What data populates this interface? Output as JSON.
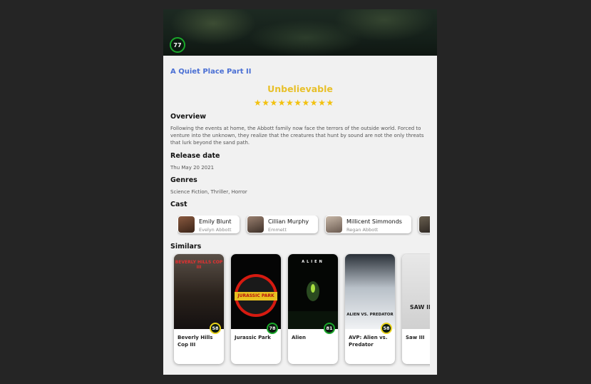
{
  "movie": {
    "score": "77",
    "title": "A Quiet Place Part II",
    "tagline": "Unbelievable",
    "stars": "★★★★★★★★★★",
    "colors": {
      "title": "#4a6fd4",
      "tagline": "#e8c02a",
      "star": "#f2c10f",
      "score_ring": "#1aa82a"
    }
  },
  "sections": {
    "overview_label": "Overview",
    "overview": "Following the events at home, the Abbott family now face the terrors of the outside world. Forced to venture into the unknown, they realize that the creatures that hunt by sound are not the only threats that lurk beyond the sand path.",
    "release_label": "Release date",
    "release": "Thu May 20 2021",
    "genres_label": "Genres",
    "genres": "Science Fiction, Thriller, Horror",
    "cast_label": "Cast",
    "similars_label": "Similars"
  },
  "cast": [
    {
      "name": "Emily Blunt",
      "role": "Evelyn Abbott"
    },
    {
      "name": "Cillian Murphy",
      "role": "Emmett"
    },
    {
      "name": "Millicent Simmonds",
      "role": "Regan Abbott"
    }
  ],
  "similars": [
    {
      "title": "Beverly Hills Cop III",
      "score": "58",
      "poster_text": "BEVERLY HILLS COP III",
      "ring": "#e8d21a"
    },
    {
      "title": "Jurassic Park",
      "score": "78",
      "poster_text": "JURASSIC PARK",
      "ring": "#1aa82a"
    },
    {
      "title": "Alien",
      "score": "81",
      "poster_text": "ALIEN",
      "ring": "#1aa82a"
    },
    {
      "title": "AVP: Alien vs. Predator",
      "score": "58",
      "poster_text": "ALIEN VS. PREDATOR",
      "ring": "#e8d21a"
    },
    {
      "title": "Saw III",
      "score": "",
      "poster_text": "SAW III",
      "ring": ""
    }
  ]
}
